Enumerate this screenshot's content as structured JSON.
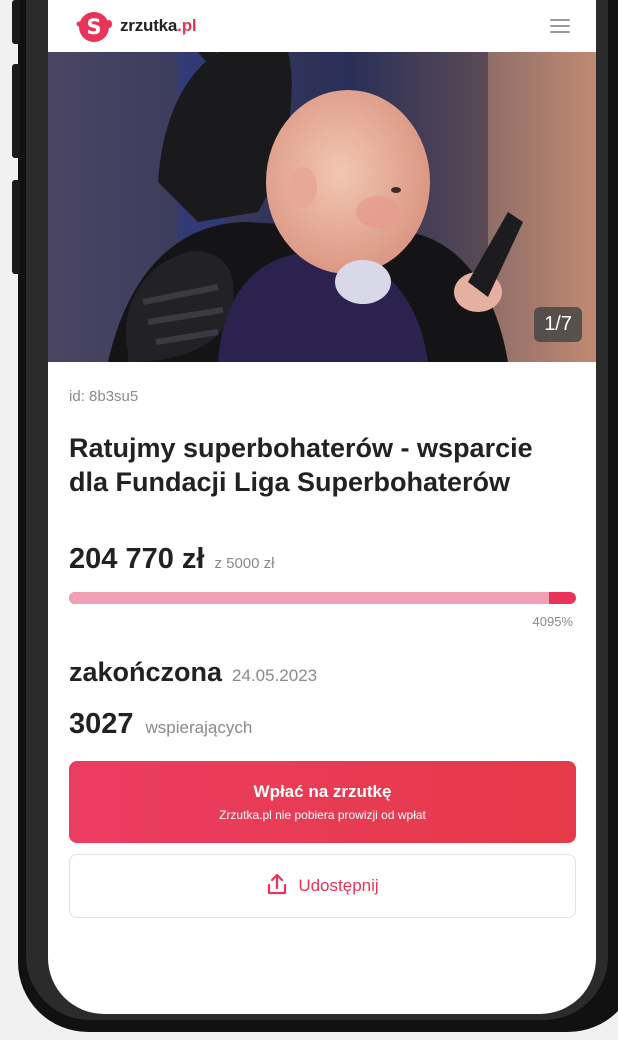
{
  "header": {
    "logo_name": "zrzutka",
    "logo_tld": ".pl",
    "menu_icon": "hamburger-menu-icon"
  },
  "hero": {
    "counter": "1/7"
  },
  "campaign": {
    "id_label": "id: 8b3su5",
    "title": "Ratujmy superbohaterów - wsparcie dla Fundacji Liga Superbohaterów",
    "raised": "204 770 zł",
    "goal": "z 5000 zł",
    "progress_fraction": 0.95,
    "percent": "4095%",
    "status": "zakończona",
    "end_date": "24.05.2023",
    "supporters_count": "3027",
    "supporters_label": "wspierających"
  },
  "actions": {
    "pay_label": "Wpłać na zrzutkę",
    "pay_sub": "Zrzutka.pl nie pobiera prowizji od wpłat",
    "share_label": "Udostępnij",
    "share_icon": "share-upload-icon"
  },
  "colors": {
    "brand": "#e8345a",
    "progress_light": "#f0a0b5"
  }
}
